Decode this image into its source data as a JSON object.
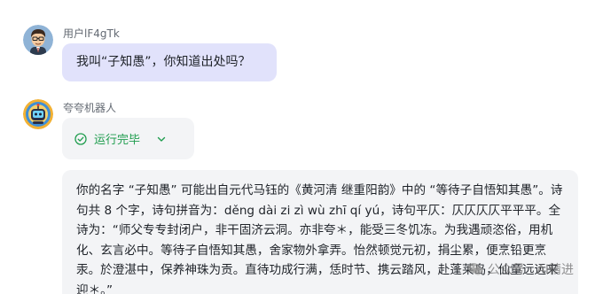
{
  "user": {
    "name": "用户lF4gTk",
    "message": "我叫“子知愚”，你知道出处吗？"
  },
  "bot": {
    "name": "夸夸机器人",
    "status": "运行完毕",
    "answer": "你的名字 “子知愚” 可能出自元代马钰的《黄河清 继重阳韵》中的 “等待子自悟知其愚”。诗句共 8 个字，诗句拼音为：děng dài zi zì wù zhī qí yú，诗句平仄：仄仄仄仄平平平。全诗为：“师父专专封闭户，非干固济云洞。亦非夸＊，能受三冬饥冻。为我遇顽恣俗，用机化、玄言必中。等待子自悟知其愚，舍家物外拿弄。怡然顿觉元初，捐尘累，便烹铅更烹汞。於澄湛中，保养神珠为贡。直待功成行满，恁时节、携云踏风，赴蓬莱岛，仙童远远来迎＊。”"
  },
  "watermark": {
    "text": "公众号 · AI精进"
  },
  "colors": {
    "user_bubble": "#e1e2fb",
    "card_bg": "#f3f4f6",
    "status_green": "#1f9d4e"
  },
  "icons": {
    "user_avatar": "cartoon-man-avatar",
    "bot_avatar": "robot-avatar",
    "status": "check-circle-icon",
    "expand": "chevron-down-icon",
    "watermark": "wechat-icon"
  }
}
